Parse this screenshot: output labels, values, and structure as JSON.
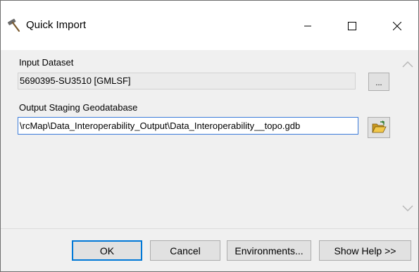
{
  "window": {
    "title": "Quick Import",
    "title_icon": "hammer-icon"
  },
  "form": {
    "input_label": "Input Dataset",
    "input_value": "5690395-SU3510 [GMLSF]",
    "browse_label": "...",
    "output_label": "Output Staging Geodatabase",
    "output_value": "\\rcMap\\Data_Interoperability_Output\\Data_Interoperability__topo.gdb",
    "output_browse_icon": "folder-open-icon"
  },
  "buttons": {
    "ok": "OK",
    "cancel": "Cancel",
    "environments": "Environments...",
    "show_help": "Show Help >>"
  },
  "colors": {
    "focus_blue": "#0078d7",
    "field_focus_border": "#3b7bd9",
    "dialog_bg": "#f0f0f0"
  }
}
